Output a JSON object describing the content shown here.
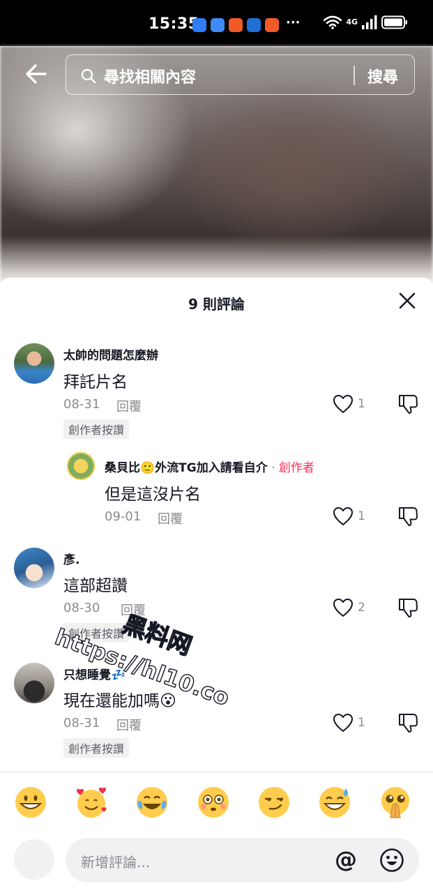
{
  "status_bar": {
    "time": "15:35",
    "more": "···",
    "network": "4G"
  },
  "search": {
    "placeholder": "尋找相關內容",
    "button_label": "搜尋"
  },
  "sheet": {
    "title": "9 則評論"
  },
  "comments": [
    {
      "username": "太帥的問題怎麼辦",
      "text": "拜託片名",
      "date": "08-31",
      "reply_label": "回覆",
      "likes": "1",
      "badge": "創作者按讚"
    },
    {
      "username": "桑貝比🙂外流TG加入請看自介",
      "creator_label": "創作者",
      "text": "但是這沒片名",
      "date": "09-01",
      "reply_label": "回覆",
      "likes": "1"
    },
    {
      "username": "彥.",
      "text": "這部超讚",
      "date": "08-30",
      "reply_label": "回覆",
      "likes": "2",
      "badge": "創作者按讚"
    },
    {
      "username": "只想睡覺💤",
      "text": "現在還能加嗎😮",
      "date": "08-31",
      "reply_label": "回覆",
      "likes": "1",
      "badge": "創作者按讚"
    }
  ],
  "emoji_bar": [
    "grinning-face",
    "smiling-face-with-hearts",
    "face-with-tears-of-joy",
    "flushed-face",
    "smirking-face",
    "grinning-face-with-sweat",
    "pleading-face-with-hands"
  ],
  "input": {
    "placeholder": "新增評論...",
    "mention_symbol": "@"
  },
  "watermark": {
    "line1": "黑料网",
    "line2": "https://hl10.co"
  },
  "colors": {
    "creator": "#fe2c55",
    "meta": "#8a8b91",
    "badge_bg": "#f1f1f2"
  }
}
